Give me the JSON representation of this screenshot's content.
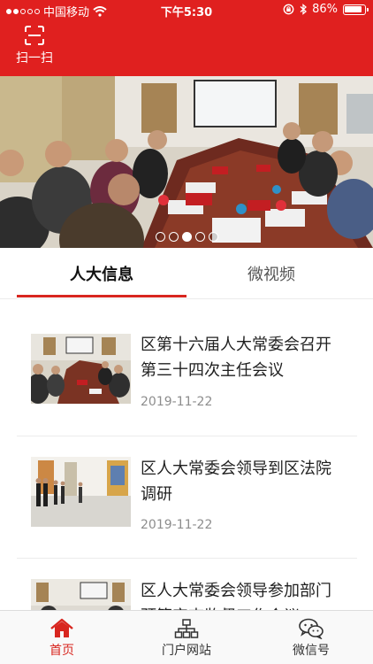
{
  "status_bar": {
    "carrier": "中国移动",
    "time": "下午5:30",
    "battery_text": "86%"
  },
  "header": {
    "scan_label": "扫一扫",
    "bg_color": "#e0201f"
  },
  "banner": {
    "page_count": 5,
    "active_page": 3
  },
  "tabs": [
    {
      "label": "人大信息",
      "active": true
    },
    {
      "label": "微视频",
      "active": false
    }
  ],
  "news": [
    {
      "title": "区第十六届人大常委会召开第三十四次主任会议",
      "date": "2019-11-22"
    },
    {
      "title": "区人大常委会领导到区法院调研",
      "date": "2019-11-22"
    },
    {
      "title": "区人大常委会领导参加部门预算审查监督工作会议",
      "date": ""
    }
  ],
  "bottom_nav": [
    {
      "label": "首页",
      "icon": "home-icon",
      "active": true
    },
    {
      "label": "门户网站",
      "icon": "sitemap-icon",
      "active": false
    },
    {
      "label": "微信号",
      "icon": "wechat-icon",
      "active": false
    }
  ],
  "colors": {
    "accent": "#d8261f",
    "date_text": "#8d8d8d"
  }
}
